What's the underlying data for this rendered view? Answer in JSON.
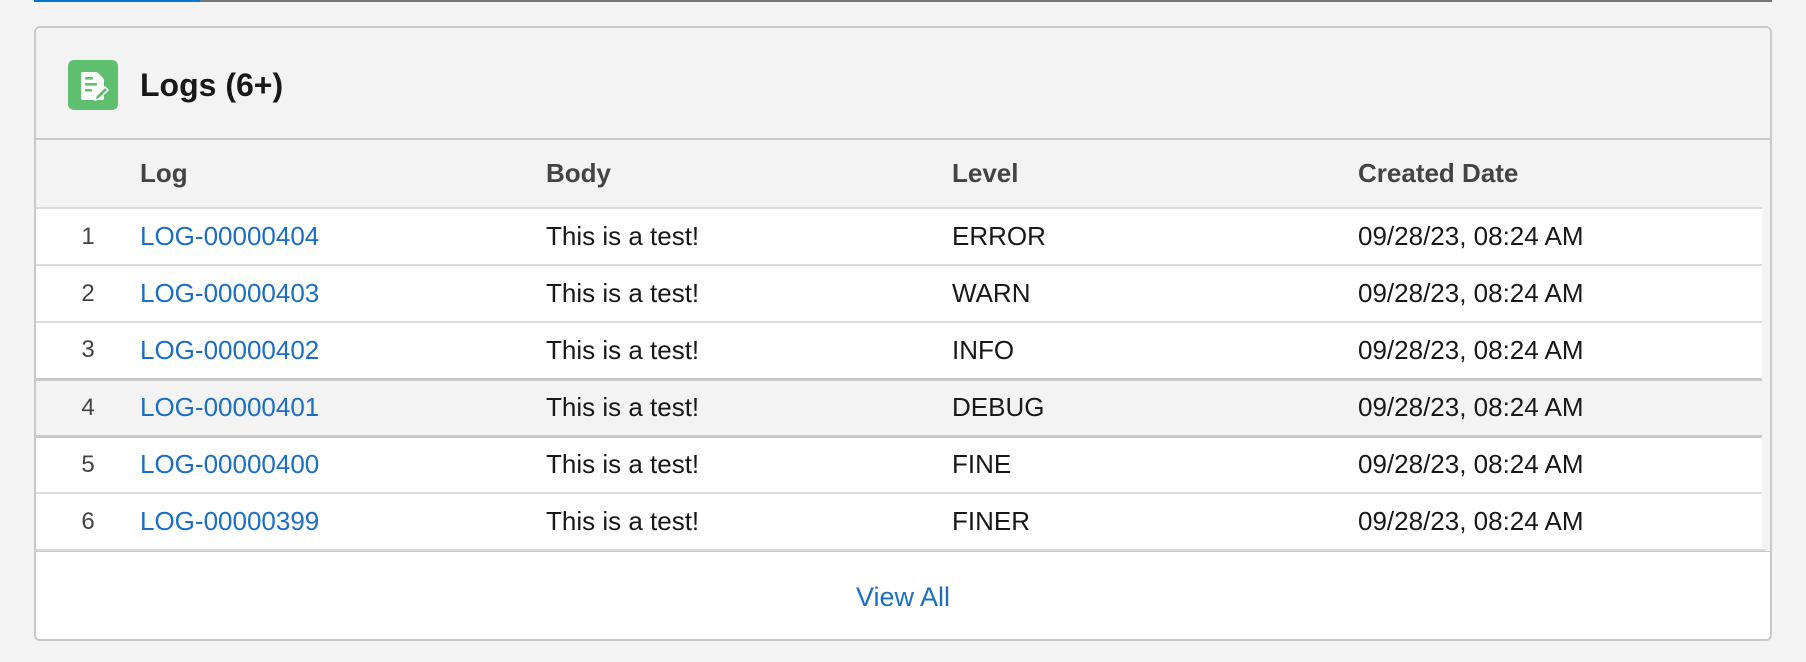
{
  "card": {
    "title": "Logs (6+)",
    "icon": "log-record-icon",
    "icon_color": "#5ebf6f"
  },
  "table": {
    "columns": [
      "",
      "Log",
      "Body",
      "Level",
      "Created Date"
    ],
    "rows": [
      {
        "num": "1",
        "log": "LOG-00000404",
        "body": "This is a test!",
        "level": "ERROR",
        "created": "09/28/23, 08:24 AM"
      },
      {
        "num": "2",
        "log": "LOG-00000403",
        "body": "This is a test!",
        "level": "WARN",
        "created": "09/28/23, 08:24 AM"
      },
      {
        "num": "3",
        "log": "LOG-00000402",
        "body": "This is a test!",
        "level": "INFO",
        "created": "09/28/23, 08:24 AM"
      },
      {
        "num": "4",
        "log": "LOG-00000401",
        "body": "This is a test!",
        "level": "DEBUG",
        "created": "09/28/23, 08:24 AM"
      },
      {
        "num": "5",
        "log": "LOG-00000400",
        "body": "This is a test!",
        "level": "FINE",
        "created": "09/28/23, 08:24 AM"
      },
      {
        "num": "6",
        "log": "LOG-00000399",
        "body": "This is a test!",
        "level": "FINER",
        "created": "09/28/23, 08:24 AM"
      }
    ]
  },
  "footer": {
    "view_all_label": "View All"
  },
  "colors": {
    "link": "#1b6ec2",
    "accent": "#0176d3"
  }
}
